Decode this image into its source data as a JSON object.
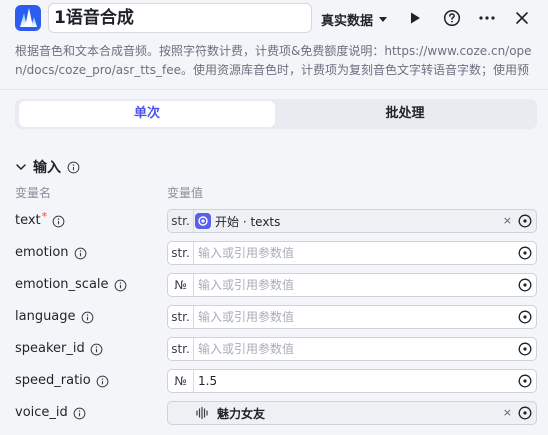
{
  "header": {
    "title": "1语音合成",
    "mode_label": "真实数据",
    "brand_color": "#2b5df0"
  },
  "description": "根据音色和文本合成音频。按照字符数计费，计费项&免费额度说明：https://www.coze.cn/open/docs/coze_pro/asr_tts_fee。使用资源库音色时，计费项为复刻音色文字转语音字数；使用预设...",
  "tabs": {
    "single": "单次",
    "batch": "批处理",
    "active_color": "#4c54f0"
  },
  "inputs_section": {
    "title": "输入",
    "col_name": "变量名",
    "col_value": "变量值"
  },
  "params": [
    {
      "name": "text",
      "required_mark": "*",
      "type": "str.",
      "ref_label": "开始 · texts",
      "clear": "×"
    },
    {
      "name": "emotion",
      "type": "str.",
      "placeholder": "输入或引用参数值"
    },
    {
      "name": "emotion_scale",
      "type": "№",
      "placeholder": "输入或引用参数值"
    },
    {
      "name": "language",
      "type": "str.",
      "placeholder": "输入或引用参数值"
    },
    {
      "name": "speaker_id",
      "type": "str.",
      "placeholder": "输入或引用参数值"
    },
    {
      "name": "speed_ratio",
      "type": "№",
      "value": "1.5"
    },
    {
      "name": "voice_id",
      "voice_name": "魅力女友",
      "clear": "×"
    }
  ]
}
